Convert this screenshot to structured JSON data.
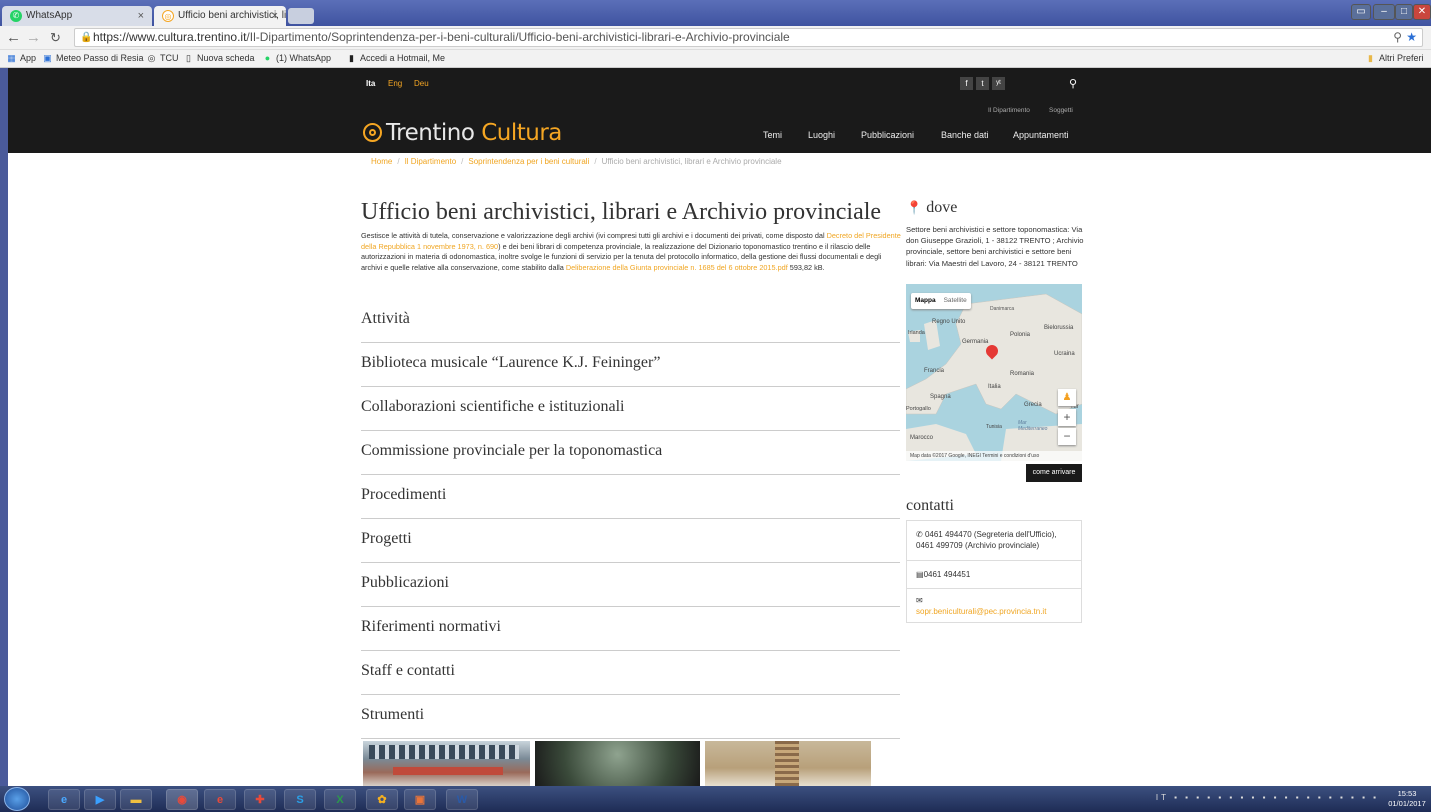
{
  "browser": {
    "tabs": [
      {
        "label": "WhatsApp",
        "close": "×"
      },
      {
        "label": "Ufficio beni archivistici, li",
        "close": "×"
      }
    ],
    "url_host": "https://www.cultura.trentino.it",
    "url_path": "/Il-Dipartimento/Soprintendenza-per-i-beni-culturali/Ufficio-beni-archivistici-librari-e-Archivio-provinciale",
    "bookmarks": [
      "App",
      "Meteo Passo di Resia",
      "TCU",
      "Nuova scheda",
      "(1) WhatsApp",
      "Accedi a Hotmail, Me"
    ],
    "other_bookmarks": "Altri Preferi"
  },
  "site": {
    "languages": [
      "Ita",
      "Eng",
      "Deu"
    ],
    "social": [
      "f",
      "t",
      "yt"
    ],
    "top_links": [
      "Il Dipartimento",
      "Soggetti"
    ],
    "logo_main": "Trentino",
    "logo_accent": "Cultura",
    "nav": [
      "Temi",
      "Luoghi",
      "Pubblicazioni",
      "Banche dati",
      "Appuntamenti"
    ]
  },
  "breadcrumb": [
    "Home",
    "Il Dipartimento",
    "Soprintendenza per i beni culturali",
    "Ufficio beni archivistici, librari e Archivio provinciale"
  ],
  "page": {
    "title": "Ufficio beni archivistici, librari e Archivio provinciale",
    "intro": {
      "t1": "Gestisce le attività di tutela, conservazione e valorizzazione degli archivi (ivi compresi tutti gli archivi e i documenti dei privati, come disposto dal ",
      "l1": "Decreto del Presidente della Repubblica 1 novembre 1973, n. 690",
      "t2": ") e dei beni librari di competenza provinciale, la realizzazione del Dizionario toponomastico trentino e il rilascio delle autorizzazioni in materia di odonomastica, inoltre svolge le funzioni di servizio per la tenuta del protocollo informatico, della gestione dei flussi documentali e degli archivi e quelle relative alla conservazione, come stabilito dalla ",
      "l2": "Deliberazione della Giunta provinciale n. 1685 del 6 ottobre 2015.pdf",
      "t3": " 593,82 kB."
    },
    "sections": [
      "Attività",
      "Biblioteca musicale “Laurence K.J. Feininger”",
      "Collaborazioni scientifiche e istituzionali",
      "Commissione provinciale per la toponomastica",
      "Procedimenti",
      "Progetti",
      "Pubblicazioni",
      "Riferimenti normativi",
      "Staff e contatti",
      "Strumenti"
    ]
  },
  "dove": {
    "title": "dove",
    "address": "Settore beni archivistici e settore toponomastica: Via don Giuseppe Grazioli, 1 - 38122 TRENTO ; Archivio provinciale, settore beni archivistici e settore beni librari: Via Maestri del Lavoro, 24 - 38121 TRENTO",
    "map_types": [
      "Mappa",
      "Satellite"
    ],
    "map_labels": [
      "Danimarca",
      "Regno Unito",
      "Irlanda",
      "Polonia",
      "Bielorussia",
      "Germania",
      "Ucraina",
      "Francia",
      "Romania",
      "Italia",
      "Spagna",
      "Grecia",
      "Portogallo",
      "Tunisia",
      "Mar Mediterraneo",
      "Marocco",
      "Tur"
    ],
    "map_footer": "Map data ©2017 Google, INEGI   Termini e condizioni d'uso",
    "directions": "come arrivare"
  },
  "contatti": {
    "title": "contatti",
    "phone": "0461 494470 (Segreteria dell'Ufficio), 0461 499709 (Archivio provinciale)",
    "fax": "0461 494451",
    "email": "sopr.beniculturali@pec.provincia.tn.it"
  },
  "taskbar": {
    "clock_time": "15:53",
    "clock_date": "01/01/2017",
    "lang": "IT"
  }
}
